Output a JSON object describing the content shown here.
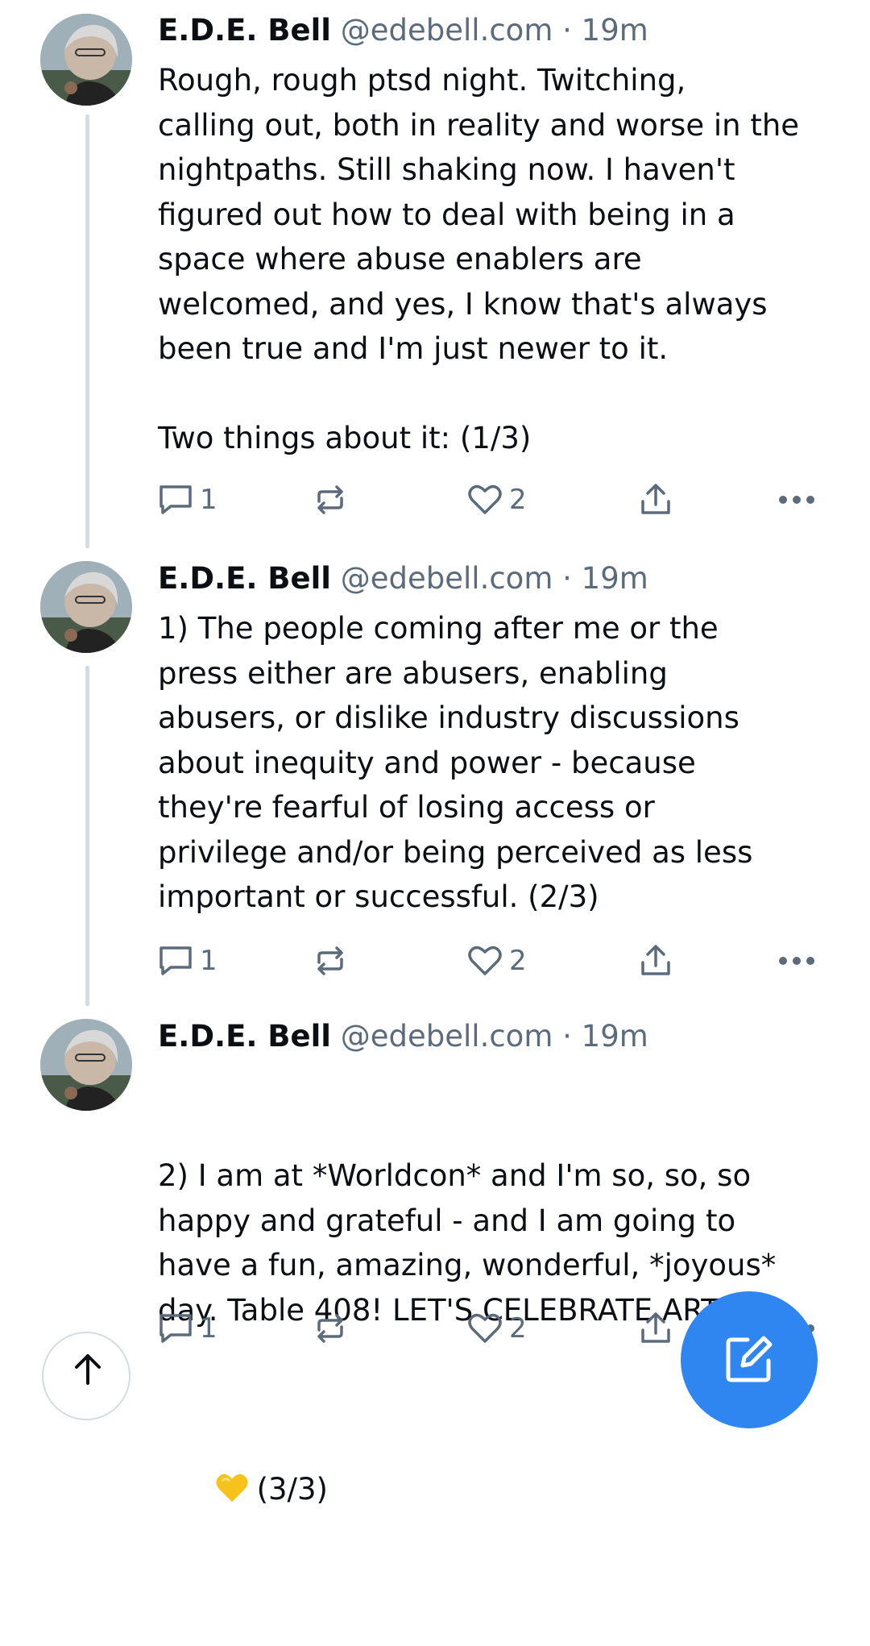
{
  "posts": [
    {
      "author_name": "E.D.E. Bell",
      "handle": "@edebell.com",
      "separator": "·",
      "time": "19m",
      "text": "Rough, rough ptsd night. Twitching,\ncalling out, both in reality and worse in the\nnightpaths. Still shaking now. I haven't\nfigured out how to deal with being in a\nspace where abuse enablers are\nwelcomed, and yes, I know that's always\nbeen true and I'm just newer to it.\n\nTwo things about it: (1/3)",
      "reply_count": "1",
      "like_count": "2"
    },
    {
      "author_name": "E.D.E. Bell",
      "handle": "@edebell.com",
      "separator": "·",
      "time": "19m",
      "text": "1) The people coming after me or the\npress either are abusers, enabling\nabusers, or dislike industry discussions\nabout inequity and power - because\nthey're fearful of losing access or\nprivilege and/or being perceived as less\nimportant or successful. (2/3)",
      "reply_count": "1",
      "like_count": "2"
    },
    {
      "author_name": "E.D.E. Bell",
      "handle": "@edebell.com",
      "separator": "·",
      "time": "19m",
      "text": "2) I am at *Worldcon* and I'm so, so, so\nhappy and grateful - and I am going to\nhave a fun, amazing, wonderful, *joyous*\nday. Table 408! LET'S CELEBRATE ART!",
      "text_last_line": "(3/3)",
      "reply_count": "1",
      "like_count": "2"
    }
  ],
  "icons": {
    "reply": "speech-bubble-icon",
    "repost": "repost-arrows-icon",
    "like": "heart-outline-icon",
    "share": "share-upload-icon",
    "more": "more-dots-icon",
    "emoji": "yellow-heart-emoji",
    "scroll_top": "arrow-up-icon",
    "compose": "compose-pencil-icon"
  },
  "colors": {
    "text": "#0b0f14",
    "muted": "#5b6b7b",
    "thread_line": "#d4dbe2",
    "fab": "#2f86f0",
    "emoji_heart": "#f7c21c"
  }
}
